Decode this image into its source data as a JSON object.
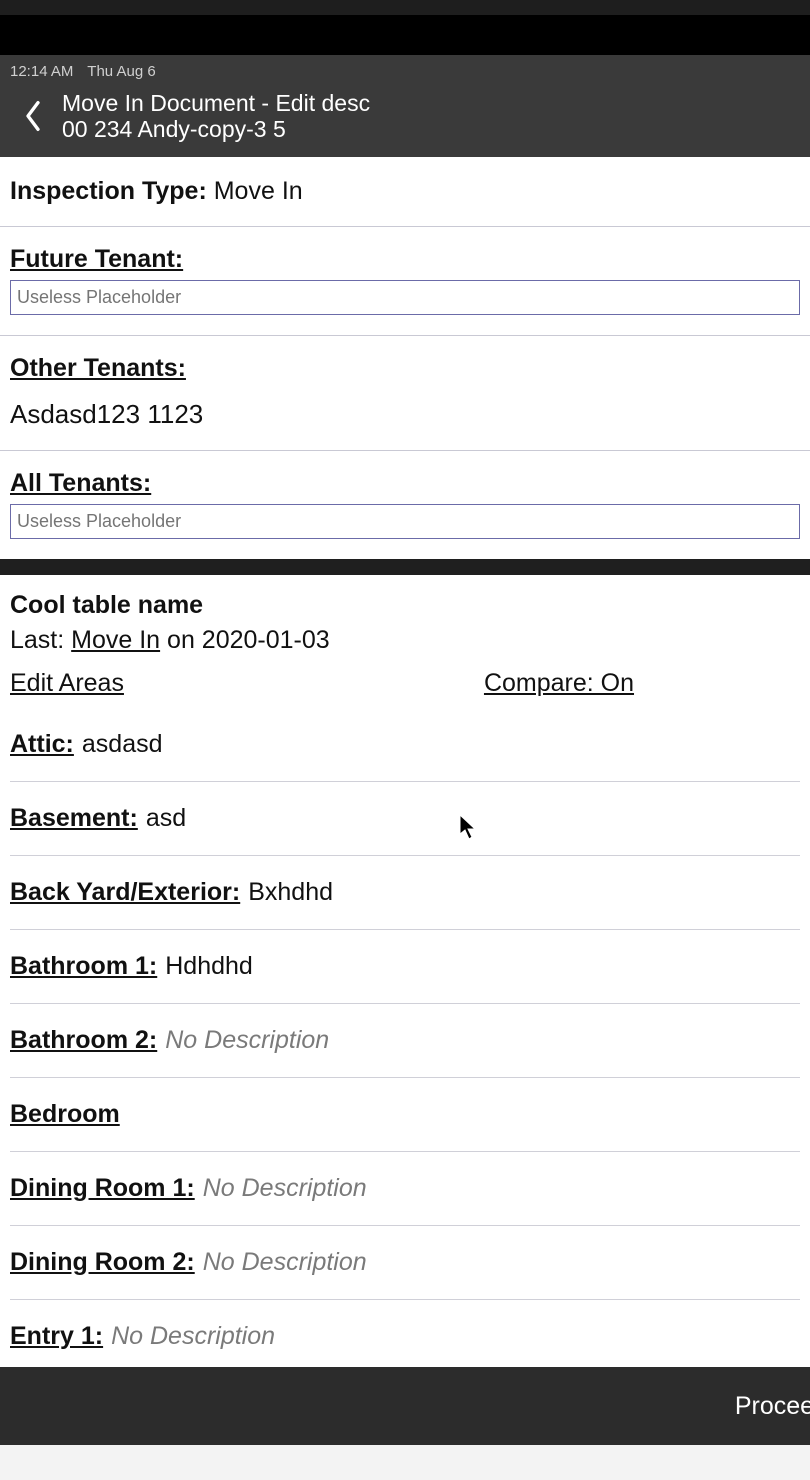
{
  "status_bar": {
    "time": "12:14 AM",
    "date": "Thu Aug 6"
  },
  "header": {
    "title_line1": "Move In Document - Edit desc",
    "title_line2": "00 234 Andy-copy-3 5"
  },
  "inspection": {
    "label": "Inspection Type:",
    "value": "Move In"
  },
  "future_tenant": {
    "label": "Future Tenant:",
    "placeholder": "Useless Placeholder"
  },
  "other_tenants": {
    "label": "Other Tenants:",
    "value": "Asdasd123 1123"
  },
  "all_tenants": {
    "label": "All Tenants:",
    "placeholder": "Useless Placeholder"
  },
  "table": {
    "title": "Cool table name",
    "last_prefix": "Last: ",
    "last_type": "Move In",
    "last_on": " on 2020-01-03",
    "edit_areas": "Edit Areas",
    "compare": "Compare: On"
  },
  "areas": [
    {
      "name": "Attic:",
      "desc": "asdasd",
      "no": false
    },
    {
      "name": "Basement:",
      "desc": "asd",
      "no": false
    },
    {
      "name": "Back Yard/Exterior:",
      "desc": "Bxhdhd",
      "no": false
    },
    {
      "name": "Bathroom 1:",
      "desc": "Hdhdhd",
      "no": false
    },
    {
      "name": "Bathroom 2:",
      "desc": "No Description",
      "no": true
    },
    {
      "name": "Bedroom",
      "desc": "",
      "no": false
    },
    {
      "name": "Dining Room 1:",
      "desc": "No Description",
      "no": true
    },
    {
      "name": "Dining Room 2:",
      "desc": "No Description",
      "no": true
    },
    {
      "name": "Entry 1:",
      "desc": "No Description",
      "no": true
    }
  ],
  "footer": {
    "proceed": "Proceed"
  }
}
